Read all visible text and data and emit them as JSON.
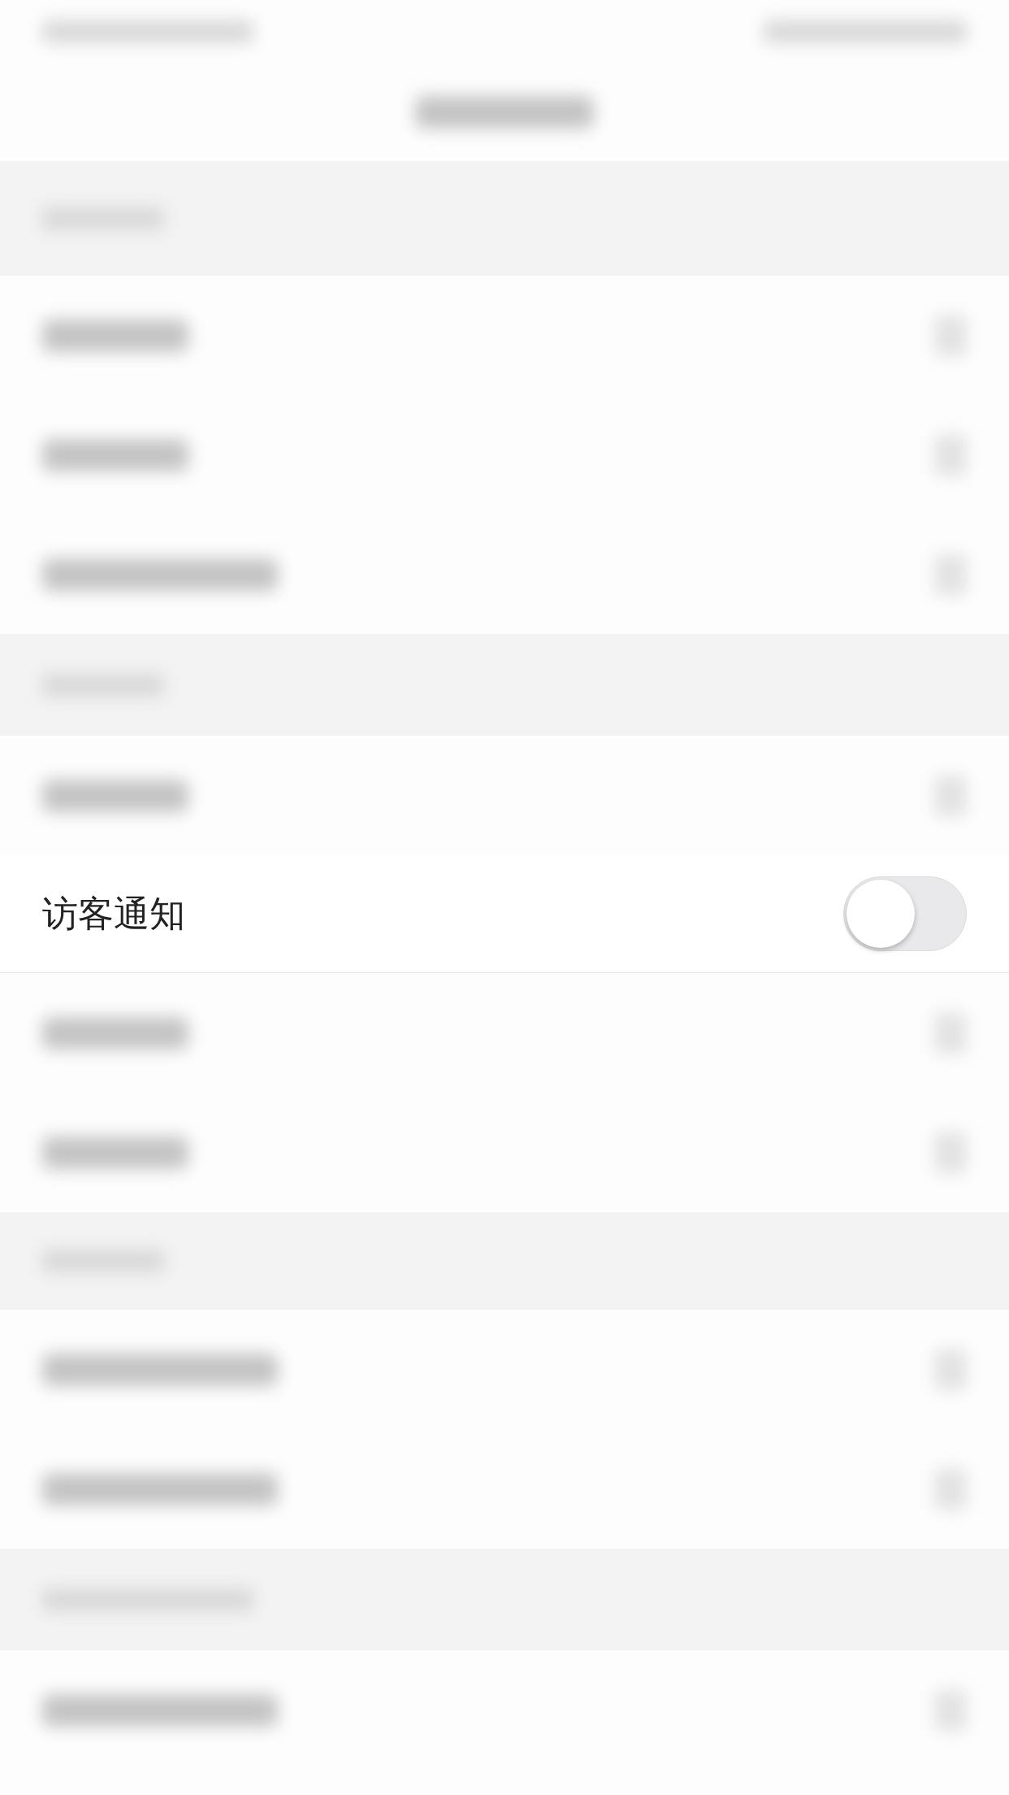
{
  "setting": {
    "label": "访客通知",
    "on": false
  }
}
